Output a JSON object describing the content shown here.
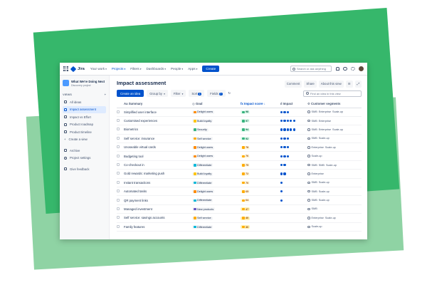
{
  "nav": {
    "logo": "Jira",
    "items": [
      "Your work",
      "Projects",
      "Filters",
      "Dashboards",
      "People",
      "Apps"
    ],
    "create": "Create",
    "search_placeholder": "Search or ask anything"
  },
  "sidebar": {
    "project_name": "What We're Doing Next",
    "project_sub": "Discovery project",
    "views_label": "VIEWS",
    "items": [
      "All ideas",
      "Impact assessment",
      "Impact vs Effort",
      "Product roadmap",
      "Product timeline",
      "Create a view"
    ],
    "bottom": [
      "Archive",
      "Project settings"
    ],
    "feedback": "Give feedback"
  },
  "page": {
    "title": "Impact assessment",
    "actions": [
      "Comment",
      "Share",
      "About this view"
    ],
    "toolbar": {
      "create": "Create an idea",
      "group": "Group by",
      "filter": "Filter",
      "sort": "Sort",
      "sort_count": "1",
      "fields": "Fields",
      "fields_count": "7",
      "search_placeholder": "Find an idea in this view"
    }
  },
  "table": {
    "headers": [
      "Summary",
      "Goal",
      "Impact score",
      "Impact",
      "Customer segments"
    ],
    "rows": [
      {
        "summary": "Simplified user interface",
        "goal": "Delight users",
        "score": "98",
        "impact": 3,
        "segments": [
          "SMB",
          "Enterprise",
          "Scale-up"
        ]
      },
      {
        "summary": "Customised experiences",
        "goal": "Build loyalty",
        "score": "97",
        "impact": 5,
        "segments": [
          "SMB",
          "Enterprise"
        ]
      },
      {
        "summary": "Biometrics",
        "goal": "Security",
        "score": "94",
        "impact": 5,
        "segments": [
          "SMB",
          "Enterprise",
          "Scale-up"
        ]
      },
      {
        "summary": "Self service: insurance",
        "goal": "Self service",
        "score": "92",
        "impact": 3,
        "segments": [
          "SMB",
          "Scale-up"
        ]
      },
      {
        "summary": "Unoseable virtual cards",
        "goal": "Delight users",
        "score": "78",
        "impact": 3,
        "segments": [
          "Enterprise",
          "Scale-up"
        ]
      },
      {
        "summary": "Budgeting tool",
        "goal": "Delight users",
        "score": "76",
        "impact": 3,
        "segments": [
          "Scale-up"
        ]
      },
      {
        "summary": "Co-checkout in",
        "goal": "Differentiate",
        "score": "75",
        "impact": 2,
        "segments": [
          "SMB",
          "SMB",
          "Scale-up"
        ]
      },
      {
        "summary": "Gold rewards: marketing push",
        "goal": "Build loyalty",
        "score": "72",
        "impact": 2,
        "segments": [
          "Enterprise"
        ]
      },
      {
        "summary": "Instant transactions",
        "goal": "Differentiate",
        "score": "70",
        "impact": 1,
        "segments": [
          "SMB",
          "Scale-up"
        ]
      },
      {
        "summary": "Automated tasks",
        "goal": "Delight users",
        "score": "65",
        "impact": 1,
        "segments": [
          "SMB",
          "Scale-up"
        ]
      },
      {
        "summary": "QR payment links",
        "goal": "Differentiate",
        "score": "64",
        "impact": 1,
        "segments": [
          "SMB",
          "Scale-up"
        ]
      },
      {
        "summary": "Managed investment",
        "goal": "New products",
        "score": "47",
        "impact": 0,
        "segments": [
          "SMB"
        ]
      },
      {
        "summary": "Self service: savings accounts",
        "goal": "Self service",
        "score": "40",
        "impact": 0,
        "segments": [
          "Enterprise",
          "Scale-up"
        ]
      },
      {
        "summary": "Family features",
        "goal": "Differentiate",
        "score": "30",
        "impact": 0,
        "segments": [
          "Scale-up"
        ]
      }
    ]
  },
  "colors": {
    "accent": "#0052cc",
    "green_bg": "#36b76b",
    "light_green_bg": "#8fd3a4",
    "goal": {
      "Delight users": "#ff8b00",
      "Build loyalty": "#ffc400",
      "Security": "#36b37e",
      "Self service": "#ffab00",
      "Differentiate": "#00b8d9",
      "New products": "#6554c0"
    }
  }
}
